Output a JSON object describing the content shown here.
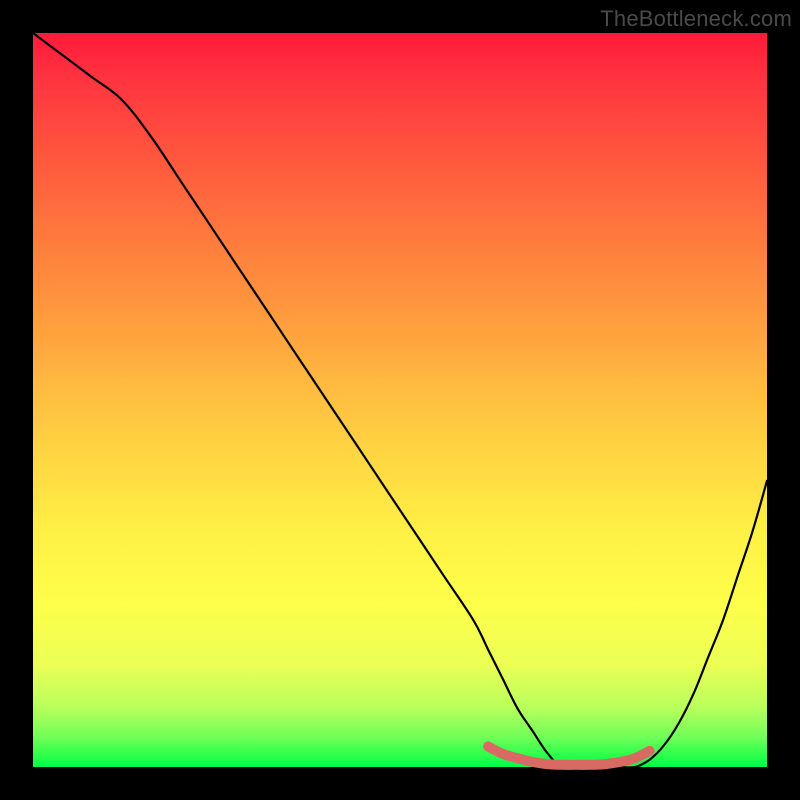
{
  "watermark": "TheBottleneck.com",
  "chart_data": {
    "type": "line",
    "title": "",
    "xlabel": "",
    "ylabel": "",
    "xlim": [
      0,
      100
    ],
    "ylim": [
      0,
      100
    ],
    "grid": false,
    "series": [
      {
        "name": "bottleneck-curve",
        "color": "#000000",
        "x": [
          0,
          4,
          8,
          12,
          16,
          20,
          24,
          28,
          32,
          36,
          40,
          44,
          48,
          52,
          56,
          60,
          62,
          64,
          66,
          68,
          70,
          72,
          74,
          76,
          78,
          80,
          82,
          84,
          86,
          88,
          90,
          92,
          94,
          96,
          98,
          100
        ],
        "values": [
          100,
          97,
          94,
          91,
          86,
          80,
          74,
          68,
          62,
          56,
          50,
          44,
          38,
          32,
          26,
          20,
          16,
          12,
          8,
          5,
          2,
          0,
          0,
          0,
          0,
          0,
          0,
          1,
          3,
          6,
          10,
          15,
          20,
          26,
          32,
          39
        ]
      },
      {
        "name": "optimal-band",
        "color": "#d96a63",
        "x": [
          62,
          64,
          66,
          68,
          70,
          72,
          74,
          76,
          78,
          80,
          82,
          84
        ],
        "values": [
          2.8,
          1.8,
          1.2,
          0.7,
          0.4,
          0.3,
          0.3,
          0.3,
          0.4,
          0.7,
          1.2,
          2.2
        ]
      }
    ]
  }
}
